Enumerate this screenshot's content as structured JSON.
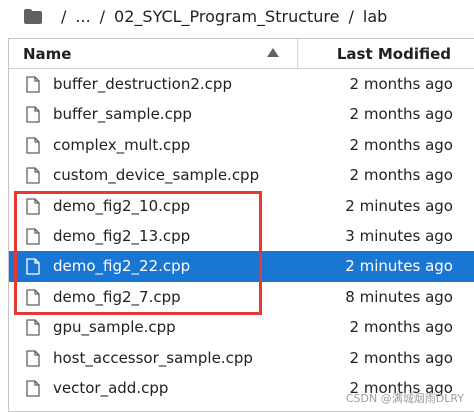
{
  "breadcrumb": {
    "root_icon": "folder-icon",
    "separator": "/",
    "ellipsis": "...",
    "folder1": "02_SYCL_Program_Structure",
    "folder2": "lab"
  },
  "header": {
    "name_label": "Name",
    "sort_icon": "triangle-up-icon",
    "modified_label": "Last Modified"
  },
  "files": [
    {
      "name": "buffer_destruction2.cpp",
      "modified": "2 months ago",
      "icon": "file-icon"
    },
    {
      "name": "buffer_sample.cpp",
      "modified": "2 months ago",
      "icon": "file-icon"
    },
    {
      "name": "complex_mult.cpp",
      "modified": "2 months ago",
      "icon": "file-icon"
    },
    {
      "name": "custom_device_sample.cpp",
      "modified": "2 months ago",
      "icon": "file-icon"
    },
    {
      "name": "demo_fig2_10.cpp",
      "modified": "2 minutes ago",
      "icon": "file-icon"
    },
    {
      "name": "demo_fig2_13.cpp",
      "modified": "3 minutes ago",
      "icon": "file-icon"
    },
    {
      "name": "demo_fig2_22.cpp",
      "modified": "2 minutes ago",
      "icon": "file-icon",
      "selected": true
    },
    {
      "name": "demo_fig2_7.cpp",
      "modified": "8 minutes ago",
      "icon": "file-icon"
    },
    {
      "name": "gpu_sample.cpp",
      "modified": "2 months ago",
      "icon": "file-icon"
    },
    {
      "name": "host_accessor_sample.cpp",
      "modified": "2 months ago",
      "icon": "file-icon"
    },
    {
      "name": "vector_add.cpp",
      "modified": "2 months ago",
      "icon": "file-icon"
    }
  ],
  "colors": {
    "selection": "#1976d2",
    "annotation": "#e53935"
  },
  "watermark": "CSDN @满城烟雨DLRY"
}
